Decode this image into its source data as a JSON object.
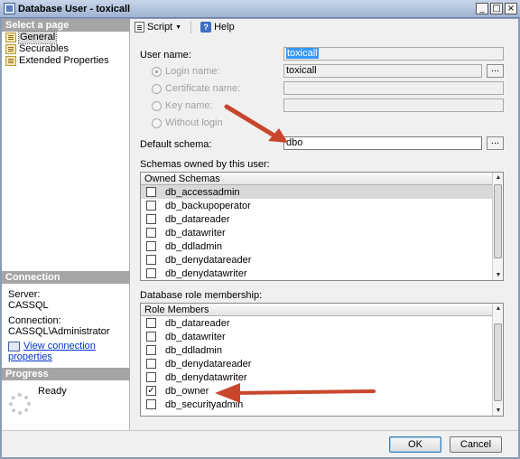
{
  "window": {
    "title": "Database User - toxicall"
  },
  "titlebar_buttons": {
    "minimize": "_",
    "maximize": "□",
    "close": "×"
  },
  "left": {
    "select_page_header": "Select a page",
    "pages": [
      {
        "label": "General",
        "icon": "page-icon",
        "selected": true
      },
      {
        "label": "Securables",
        "icon": "page-icon",
        "selected": false
      },
      {
        "label": "Extended Properties",
        "icon": "page-icon",
        "selected": false
      }
    ],
    "connection_header": "Connection",
    "server_label": "Server:",
    "server_value": "CASSQL",
    "connection_label": "Connection:",
    "connection_value": "CASSQL\\Administrator",
    "view_connection": "View connection properties",
    "progress_header": "Progress",
    "progress_status": "Ready"
  },
  "toolbar": {
    "script": "Script",
    "help": "Help"
  },
  "form": {
    "user_name_label": "User name:",
    "user_name_value": "toxicall",
    "login_name_label": "Login name:",
    "login_name_value": "toxicall",
    "certificate_label": "Certificate name:",
    "key_label": "Key name:",
    "without_login_label": "Without login",
    "default_schema_label": "Default schema:",
    "default_schema_value": "dbo",
    "browse": "..."
  },
  "schemas": {
    "group_label": "Schemas owned by this user:",
    "column": "Owned Schemas",
    "rows": [
      {
        "name": "db_accessadmin",
        "checked": false
      },
      {
        "name": "db_backupoperator",
        "checked": false
      },
      {
        "name": "db_datareader",
        "checked": false
      },
      {
        "name": "db_datawriter",
        "checked": false
      },
      {
        "name": "db_ddladmin",
        "checked": false
      },
      {
        "name": "db_denydatareader",
        "checked": false
      },
      {
        "name": "db_denydatawriter",
        "checked": false
      }
    ]
  },
  "roles": {
    "group_label": "Database role membership:",
    "column": "Role Members",
    "rows": [
      {
        "name": "db_datareader",
        "checked": false
      },
      {
        "name": "db_datawriter",
        "checked": false
      },
      {
        "name": "db_ddladmin",
        "checked": false
      },
      {
        "name": "db_denydatareader",
        "checked": false
      },
      {
        "name": "db_denydatawriter",
        "checked": false
      },
      {
        "name": "db_owner",
        "checked": true
      },
      {
        "name": "db_securityadmin",
        "checked": false
      }
    ]
  },
  "buttons": {
    "ok": "OK",
    "cancel": "Cancel"
  },
  "colors": {
    "annotation_arrow": "#c8462c",
    "link": "#0033cc"
  }
}
